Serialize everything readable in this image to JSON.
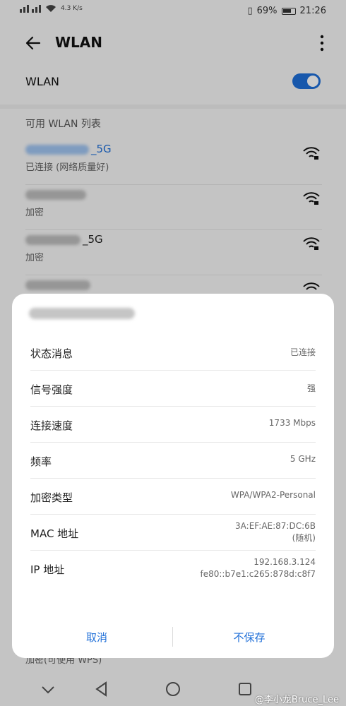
{
  "status_bar": {
    "net_speed": "4.3 K/s",
    "battery_pct": "69%",
    "time": "21:26"
  },
  "app_bar": {
    "title": "WLAN"
  },
  "wlan_toggle": {
    "label": "WLAN",
    "on": true
  },
  "networks_section": {
    "title": "可用 WLAN 列表",
    "networks": [
      {
        "ssid_suffix": "_5G",
        "sub": "已连接 (网络质量好)",
        "connected": true
      },
      {
        "ssid_suffix": "",
        "sub": "加密"
      },
      {
        "ssid_suffix": "_5G",
        "sub": "加密"
      },
      {
        "ssid_suffix": "",
        "sub": ""
      }
    ],
    "bottom_sub": "加密(可使用 WPS)"
  },
  "dialog": {
    "rows": [
      {
        "key": "状态消息",
        "value": "已连接"
      },
      {
        "key": "信号强度",
        "value": "强"
      },
      {
        "key": "连接速度",
        "value": "1733 Mbps"
      },
      {
        "key": "频率",
        "value": "5 GHz"
      },
      {
        "key": "加密类型",
        "value": "WPA/WPA2-Personal"
      },
      {
        "key": "MAC 地址",
        "value_line1": "3A:EF:AE:87:DC:6B",
        "value_line2": "(随机)"
      },
      {
        "key": "IP 地址",
        "value_line1": "192.168.3.124",
        "value_line2": "fe80::b7e1:c265:878d:c8f7"
      }
    ],
    "cancel_label": "取消",
    "forget_label": "不保存"
  },
  "watermark": "@李小龙Bruce_Lee",
  "colors": {
    "accent": "#1f6fd8"
  }
}
